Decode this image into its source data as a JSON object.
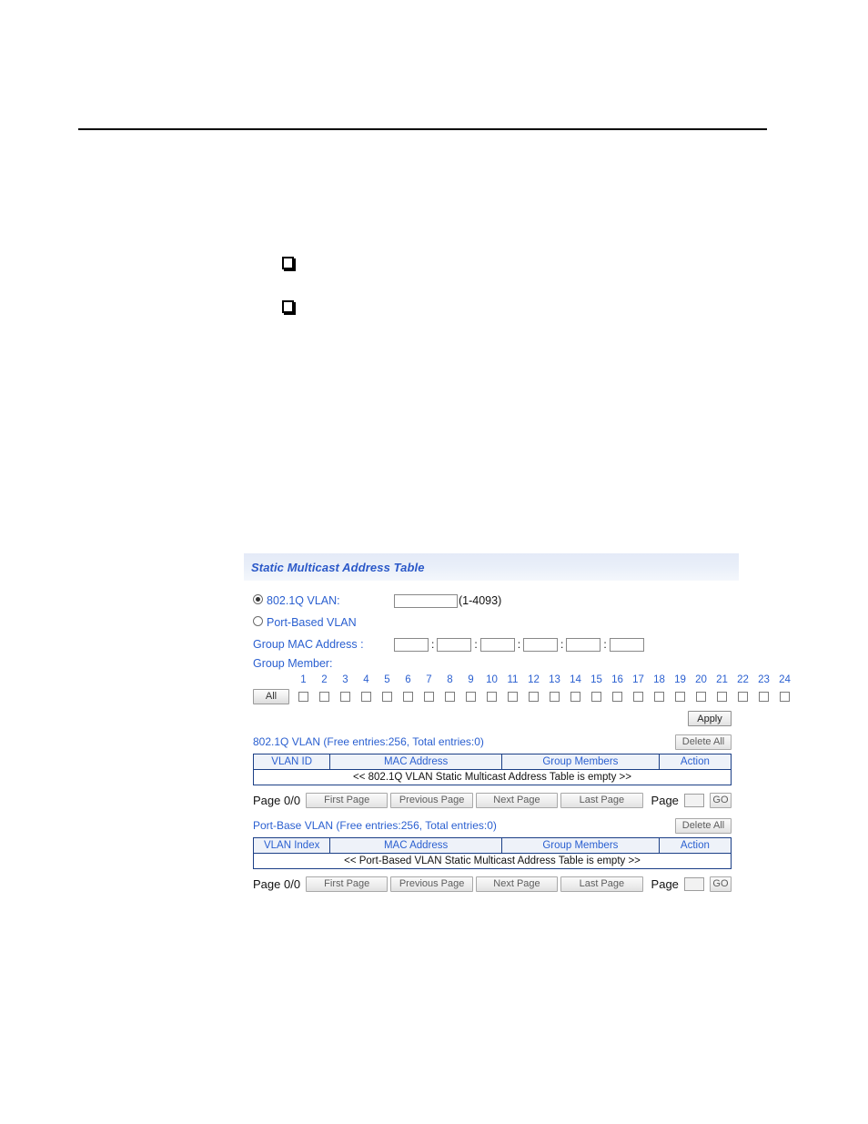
{
  "document": {
    "bullets": [
      "square-bullet",
      "square-bullet"
    ]
  },
  "panel": {
    "title": "Static Multicast Address Table",
    "form": {
      "vlan_8021q": {
        "label": "802.1Q VLAN:",
        "selected": true,
        "input_value": "",
        "range_hint": "(1-4093)"
      },
      "vlan_port_based": {
        "label": "Port-Based VLAN",
        "selected": false
      },
      "group_mac": {
        "label": "Group MAC Address :",
        "separator": ":",
        "octets": [
          "",
          "",
          "",
          "",
          "",
          ""
        ]
      },
      "group_member": {
        "label": "Group Member:",
        "all_button": "All",
        "ports": [
          1,
          2,
          3,
          4,
          5,
          6,
          7,
          8,
          9,
          10,
          11,
          12,
          13,
          14,
          15,
          16,
          17,
          18,
          19,
          20,
          21,
          22,
          23,
          24
        ],
        "checked": []
      },
      "apply_button": "Apply"
    },
    "tables": [
      {
        "caption": "802.1Q VLAN (Free entries:256, Total entries:0)",
        "delete_all_button": "Delete All",
        "columns": [
          "VLAN ID",
          "MAC Address",
          "Group Members",
          "Action"
        ],
        "empty_message": "<< 802.1Q VLAN Static Multicast Address Table is empty >>",
        "rows": [],
        "pager": {
          "page_status": "Page 0/0",
          "first": "First Page",
          "previous": "Previous Page",
          "next": "Next Page",
          "last": "Last Page",
          "page_label": "Page",
          "page_input": "",
          "go": "GO"
        }
      },
      {
        "caption": "Port-Base VLAN (Free entries:256, Total entries:0)",
        "delete_all_button": "Delete All",
        "columns": [
          "VLAN Index",
          "MAC Address",
          "Group Members",
          "Action"
        ],
        "empty_message": "<< Port-Based VLAN Static Multicast Address Table is empty >>",
        "rows": [],
        "pager": {
          "page_status": "Page 0/0",
          "first": "First Page",
          "previous": "Previous Page",
          "next": "Next Page",
          "last": "Last Page",
          "page_label": "Page",
          "page_input": "",
          "go": "GO"
        }
      }
    ]
  },
  "colors": {
    "link_blue": "#2a5fd0",
    "title_blue": "#2a58c8",
    "table_border": "#1b3f86",
    "table_header_bg": "#eef2f9",
    "panel_header_bg": "#e6ecf8"
  }
}
